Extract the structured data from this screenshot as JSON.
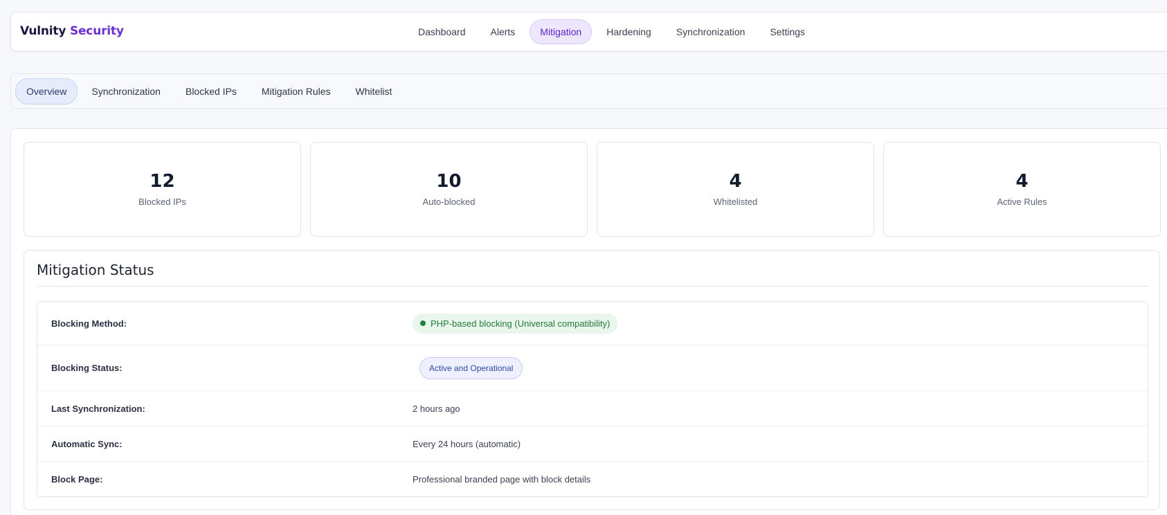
{
  "header": {
    "brand_part1": "Vulnity",
    "brand_part2": "Security",
    "nav": [
      {
        "label": "Dashboard"
      },
      {
        "label": "Alerts"
      },
      {
        "label": "Mitigation"
      },
      {
        "label": "Hardening"
      },
      {
        "label": "Synchronization"
      },
      {
        "label": "Settings"
      }
    ],
    "active_nav": "Mitigation"
  },
  "subtabs": [
    {
      "label": "Overview"
    },
    {
      "label": "Synchronization"
    },
    {
      "label": "Blocked IPs"
    },
    {
      "label": "Mitigation Rules"
    },
    {
      "label": "Whitelist"
    }
  ],
  "active_subtab": "Overview",
  "stats": [
    {
      "value": "12",
      "label": "Blocked IPs"
    },
    {
      "value": "10",
      "label": "Auto-blocked"
    },
    {
      "value": "4",
      "label": "Whitelisted"
    },
    {
      "value": "4",
      "label": "Active Rules"
    }
  ],
  "status": {
    "title": "Mitigation Status",
    "rows": [
      {
        "label": "Blocking Method:",
        "value": "PHP-based blocking (Universal compatibility)"
      },
      {
        "label": "Blocking Status:",
        "value": "Active and Operational"
      },
      {
        "label": "Last Synchronization:",
        "value": "2 hours ago"
      },
      {
        "label": "Automatic Sync:",
        "value": "Every 24 hours (automatic)"
      },
      {
        "label": "Block Page:",
        "value": "Professional branded page with block details"
      }
    ]
  },
  "colors": {
    "brand_dark": "#1b1740",
    "brand_accent": "#6b2fd6",
    "status_green": "#22823d",
    "status_blue": "#2f47a3"
  }
}
